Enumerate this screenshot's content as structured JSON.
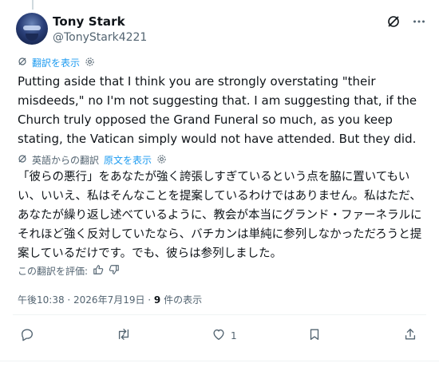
{
  "author": {
    "name": "Tony Stark",
    "handle": "@TonyStark4221"
  },
  "translation_bar": {
    "show_translation": "翻訳を表示"
  },
  "post": {
    "text": "Putting aside that I think you are strongly overstating \"their misdeeds,\" no I'm not suggesting that. I am suggesting that, if the Church truly opposed the Grand Funeral so much, as you keep stating, the Vatican simply would not have attended. But they did."
  },
  "translation": {
    "source_label": "英語からの翻訳",
    "show_original": "原文を表示",
    "text": "「彼らの悪行」をあなたが強く誇張しすぎているという点を脇に置いてもいい、いいえ、私はそんなことを提案しているわけではありません。私はただ、あなたが繰り返し述べているように、教会が本当にグランド・ファーネラルにそれほど強く反対していたなら、バチカンは単純に参列しなかっただろうと提案しているだけです。でも、彼らは参列しました。",
    "rate_label": "この翻訳を評価:"
  },
  "meta": {
    "timestamp": "午後10:38 · 2026年7月19日 · ",
    "views_count": "9",
    "views_label": " 件の表示"
  },
  "actions": {
    "like_count": "1"
  },
  "colors": {
    "link": "#1d9bf0",
    "secondary_text": "#536471",
    "divider": "#eff3f4"
  }
}
